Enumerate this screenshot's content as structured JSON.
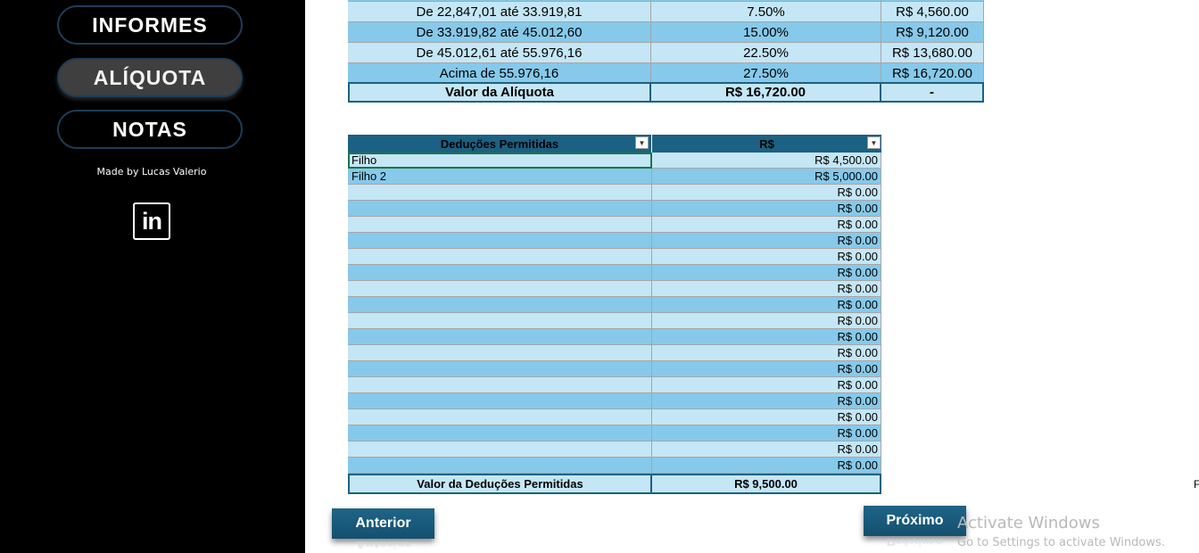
{
  "sidebar": {
    "buttons": [
      {
        "label": "INFORMES"
      },
      {
        "label": "ALÍQUOTA"
      },
      {
        "label": "NOTAS"
      }
    ],
    "credit": "Made by Lucas Valerio",
    "linkedin_text": "in"
  },
  "aliquota_table": {
    "rows": [
      {
        "faixa": "De 22,847,01 até 33.919,81",
        "aliquota": "7.50%",
        "deducao": "R$ 4,560.00"
      },
      {
        "faixa": "De 33.919,82 até 45.012,60",
        "aliquota": "15.00%",
        "deducao": "R$ 9,120.00"
      },
      {
        "faixa": "De 45.012,61 até 55.976,16",
        "aliquota": "22.50%",
        "deducao": "R$ 13,680.00"
      },
      {
        "faixa": "Acima de 55.976,16",
        "aliquota": "27.50%",
        "deducao": "R$ 16,720.00"
      }
    ],
    "total": {
      "label": "Valor da Alíquota",
      "value": "R$ 16,720.00",
      "extra": "-"
    }
  },
  "deducoes_table": {
    "headers": [
      "Deduções Permitidas",
      "R$"
    ],
    "rows": [
      {
        "name": "Filho",
        "value": "R$ 4,500.00"
      },
      {
        "name": "Filho 2",
        "value": "R$ 5,000.00"
      },
      {
        "name": "",
        "value": "R$ 0.00"
      },
      {
        "name": "",
        "value": "R$ 0.00"
      },
      {
        "name": "",
        "value": "R$ 0.00"
      },
      {
        "name": "",
        "value": "R$ 0.00"
      },
      {
        "name": "",
        "value": "R$ 0.00"
      },
      {
        "name": "",
        "value": "R$ 0.00"
      },
      {
        "name": "",
        "value": "R$ 0.00"
      },
      {
        "name": "",
        "value": "R$ 0.00"
      },
      {
        "name": "",
        "value": "R$ 0.00"
      },
      {
        "name": "",
        "value": "R$ 0.00"
      },
      {
        "name": "",
        "value": "R$ 0.00"
      },
      {
        "name": "",
        "value": "R$ 0.00"
      },
      {
        "name": "",
        "value": "R$ 0.00"
      },
      {
        "name": "",
        "value": "R$ 0.00"
      },
      {
        "name": "",
        "value": "R$ 0.00"
      },
      {
        "name": "",
        "value": "R$ 0.00"
      },
      {
        "name": "",
        "value": "R$ 0.00"
      },
      {
        "name": "",
        "value": "R$ 0.00"
      }
    ],
    "total": {
      "label": "Valor da Deduções Permitidas",
      "value": "R$ 9,500.00"
    }
  },
  "buttons": {
    "previous": "Anterior",
    "next": "Próximo"
  },
  "watermark": {
    "title": "Activate Windows",
    "subtitle": "Go to Settings to activate Windows."
  },
  "edge_char": "F",
  "colors": {
    "header": "#1b6184",
    "band_dark": "#86c9ea",
    "band_light": "#c5e6f5",
    "sidebar": "#000000"
  }
}
